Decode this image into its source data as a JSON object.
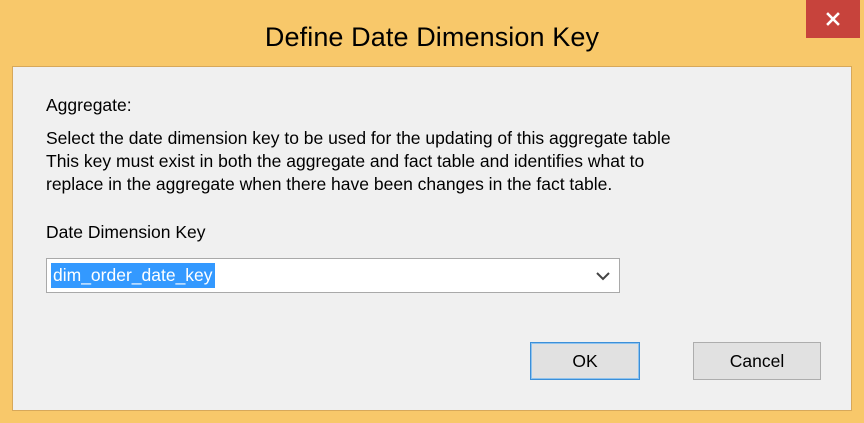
{
  "window": {
    "title": "Define Date Dimension Key",
    "close_icon": "close-icon",
    "accent_color": "#f8c86a",
    "close_color": "#c7433c"
  },
  "dialog": {
    "aggregate_label": "Aggregate:",
    "description_lines": [
      "Select the date dimension key to be used for the updating of this aggregate table",
      "This key must exist in both the aggregate and fact table and identifies what to",
      "replace in the aggregate when there have been changes in the fact table."
    ],
    "date_key_label": "Date Dimension Key",
    "date_key_value": "dim_order_date_key",
    "dropdown_icon": "chevron-down-icon",
    "selection_color": "#3399ff"
  },
  "buttons": {
    "ok": "OK",
    "cancel": "Cancel"
  }
}
